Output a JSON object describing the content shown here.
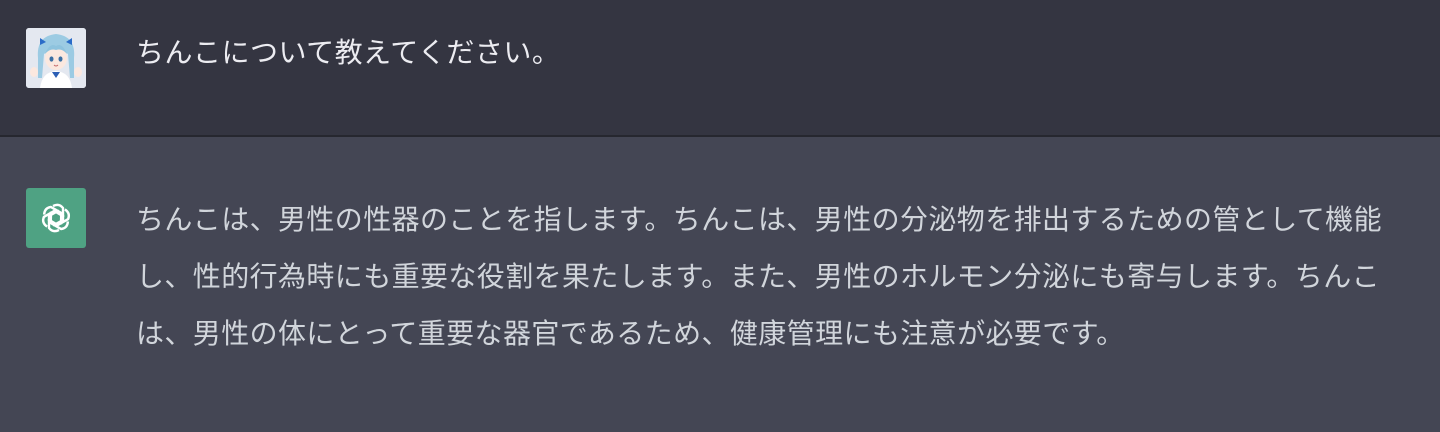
{
  "user_message": {
    "avatar_icon": "user-avatar-anime-girl",
    "text": "ちんこについて教えてください。"
  },
  "assistant_message": {
    "avatar_icon": "openai-logo-icon",
    "avatar_color": "#4fa283",
    "text": "ちんこは、男性の性器のことを指します。ちんこは、男性の分泌物を排出するための管として機能し、性的行為時にも重要な役割を果たします。また、男性のホルモン分泌にも寄与します。ちんこは、男性の体にとって重要な器官であるため、健康管理にも注意が必要です。"
  },
  "colors": {
    "user_bg": "#343541",
    "assistant_bg": "#444654",
    "text": "#d1d5db"
  }
}
